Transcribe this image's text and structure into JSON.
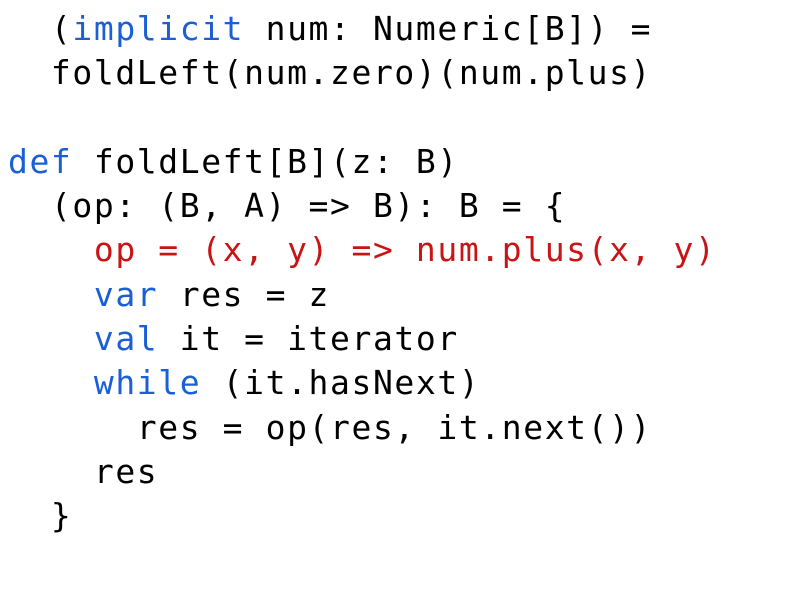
{
  "colors": {
    "background": "#ffffff",
    "text": "#000000",
    "keyword": "#1a5fd6",
    "highlight": "#c81414"
  },
  "code": {
    "l1_pre": "  (",
    "l1_kw": "implicit",
    "l1_post": " num: Numeric[B]) =",
    "l2": "  foldLeft(num.zero)(num.plus)",
    "l3": "",
    "l4_kw": "def",
    "l4_post": " foldLeft[B](z: B)",
    "l5": "  (op: (B, A) => B): B = {",
    "l6_indent": "    ",
    "l6_hl": "op = (x, y) => num.plus(x, y)",
    "l7_indent": "    ",
    "l7_kw": "var",
    "l7_post": " res = z",
    "l8_indent": "    ",
    "l8_kw": "val",
    "l8_post": " it = iterator",
    "l9_indent": "    ",
    "l9_kw": "while",
    "l9_post": " (it.hasNext)",
    "l10": "      res = op(res, it.next())",
    "l11": "    res",
    "l12": "  }"
  }
}
